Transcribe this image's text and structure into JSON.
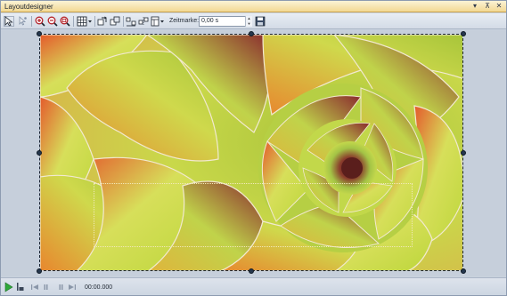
{
  "window": {
    "title": "Layoutdesigner"
  },
  "title_controls": {
    "dropdown": "▾",
    "pin": "⊼",
    "close": "✕"
  },
  "toolbar": {
    "zeitmarke_label": "Zeitmarke:",
    "zeitmarke_value": "0,00 s",
    "icons": [
      "pointer-select-icon",
      "group-select-icon",
      "zoom-in-icon",
      "zoom-out-icon",
      "zoom-fit-icon",
      "grid-icon",
      "grid-dropdown-icon",
      "move-object-icon",
      "copy-object-icon",
      "align-icon",
      "distribute-icon",
      "layout-icon",
      "layout-dropdown-icon",
      "save-icon"
    ]
  },
  "playback": {
    "timecode": "00:00.000",
    "icons": [
      "play-icon",
      "stop-to-start-icon",
      "skip-back-icon",
      "step-back-icon",
      "step-forward-icon",
      "skip-forward-icon"
    ]
  },
  "colors": {
    "titlebar": "#f3d892",
    "background": "#c6cfdb",
    "frame_border": "#1c2430",
    "handle": "#25374d",
    "play_green": "#2fa83a"
  }
}
